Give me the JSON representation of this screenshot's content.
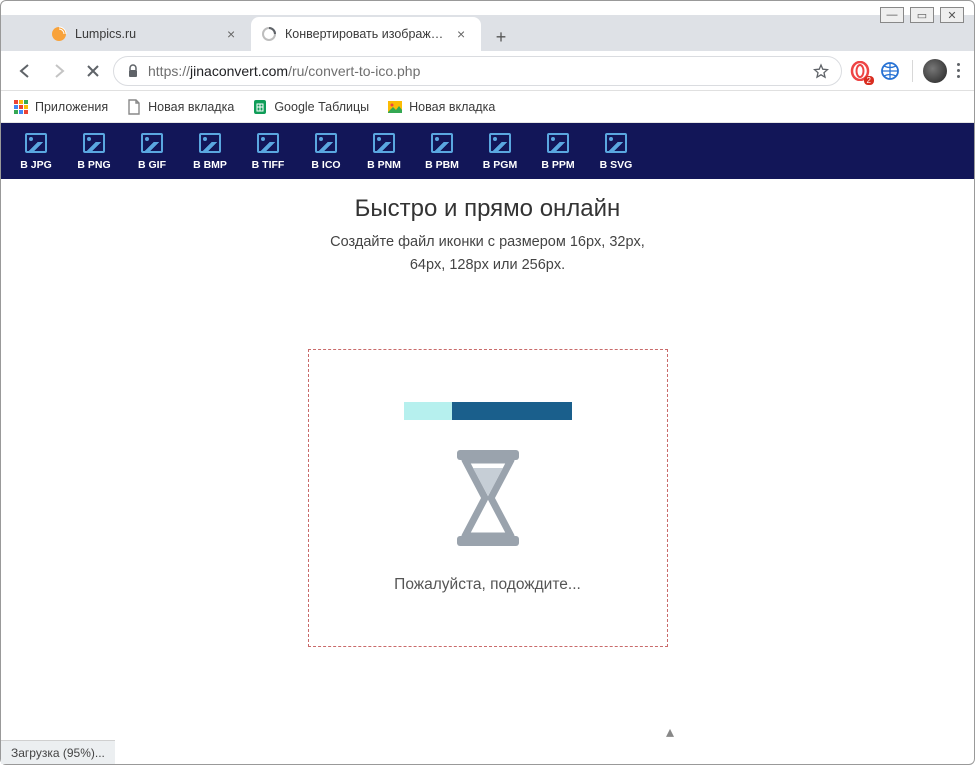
{
  "window": {
    "controls": {
      "min": "—",
      "max": "▭",
      "close": "✕"
    }
  },
  "tabs": [
    {
      "title": "Lumpics.ru",
      "active": false
    },
    {
      "title": "Конвертировать изображения в",
      "active": true
    }
  ],
  "addressbar": {
    "protocol": "https://",
    "host": "jinaconvert.com",
    "path": "/ru/convert-to-ico.php"
  },
  "extensions": {
    "opera_badge": "2"
  },
  "bookmarks": [
    {
      "label": "Приложения",
      "icon": "apps"
    },
    {
      "label": "Новая вкладка",
      "icon": "page"
    },
    {
      "label": "Google Таблицы",
      "icon": "sheets"
    },
    {
      "label": "Новая вкладка",
      "icon": "picture"
    }
  ],
  "formats": [
    "В JPG",
    "В PNG",
    "В GIF",
    "В BMP",
    "В TIFF",
    "В ICO",
    "В PNM",
    "В PBM",
    "В PGM",
    "В PPM",
    "В SVG"
  ],
  "page": {
    "heading": "Быстро и прямо онлайн",
    "subtext_line1": "Создайте файл иконки с размером 16px, 32px,",
    "subtext_line2": "64px, 128px или 256px.",
    "wait": "Пожалуйста, подождите..."
  },
  "status": "Загрузка (95%)..."
}
